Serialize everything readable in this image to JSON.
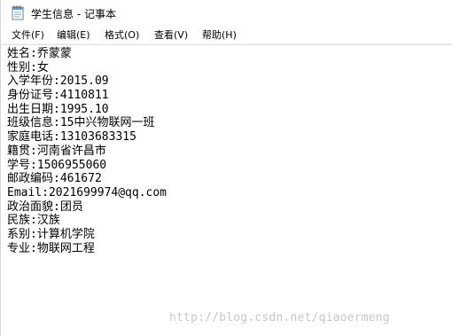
{
  "window": {
    "title": "学生信息 - 记事本",
    "icon": "notepad-icon"
  },
  "menubar": {
    "items": [
      "文件(F)",
      "编辑(E)",
      "格式(O)",
      "查看(V)",
      "帮助(H)"
    ]
  },
  "document": {
    "lines": [
      "姓名:乔蒙蒙",
      "性别:女",
      "入学年份:2015.09",
      "身份证号:4110811",
      "出生日期:1995.10",
      "班级信息:15中兴物联网一班",
      "家庭电话:13103683315",
      "籍贯:河南省许昌市",
      "学号:1506955060",
      "邮政编码:461672",
      "Email:2021699974@qq.com",
      "政治面貌:团员",
      "民族:汉族",
      "系别:计算机学院",
      "专业:物联网工程"
    ]
  },
  "watermark": {
    "text": "http://blog.csdn.net/qiaoermeng"
  }
}
